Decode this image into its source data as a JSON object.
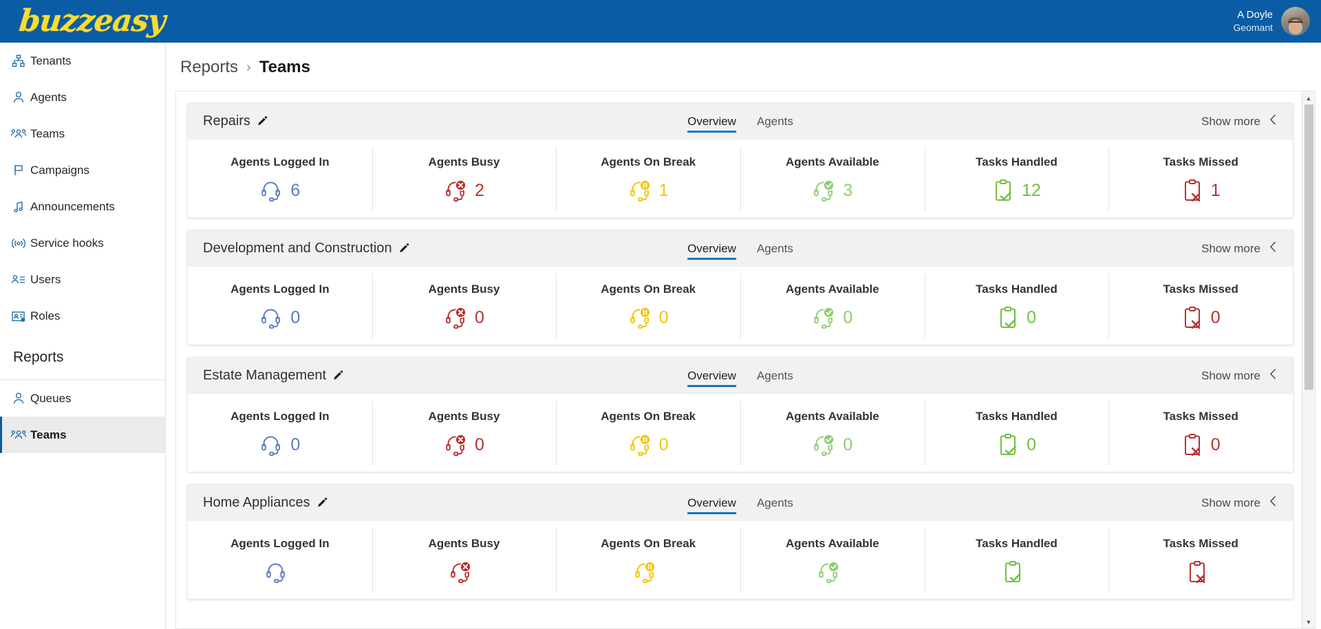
{
  "header": {
    "logo_text": "buzzeasy",
    "logo_color": "#fcdb2e",
    "bar_color": "#0a5ca4",
    "user": {
      "name": "A Doyle",
      "org": "Geomant"
    }
  },
  "sidebar": {
    "items": [
      {
        "label": "Tenants",
        "icon": "org-chart-icon",
        "active": false
      },
      {
        "label": "Agents",
        "icon": "person-icon",
        "active": false
      },
      {
        "label": "Teams",
        "icon": "people-group-icon",
        "active": false
      },
      {
        "label": "Campaigns",
        "icon": "flag-icon",
        "active": false
      },
      {
        "label": "Announcements",
        "icon": "music-note-icon",
        "active": false
      },
      {
        "label": "Service hooks",
        "icon": "broadcast-icon",
        "active": false
      },
      {
        "label": "Users",
        "icon": "person-list-icon",
        "active": false
      },
      {
        "label": "Roles",
        "icon": "badge-gear-icon",
        "active": false
      }
    ],
    "reports_heading": "Reports",
    "reports_items": [
      {
        "label": "Queues",
        "icon": "person-icon",
        "active": false
      },
      {
        "label": "Teams",
        "icon": "people-group-icon",
        "active": true
      }
    ]
  },
  "breadcrumb": {
    "parent": "Reports",
    "separator": "›",
    "current": "Teams"
  },
  "card_common": {
    "tabs": [
      {
        "label": "Overview",
        "active": true
      },
      {
        "label": "Agents",
        "active": false
      }
    ],
    "show_more_label": "Show more",
    "show_more_icon": "chevron-left-icon",
    "edit_icon": "pencil-icon",
    "metric_labels": [
      "Agents Logged In",
      "Agents Busy",
      "Agents On Break",
      "Agents Available",
      "Tasks Handled",
      "Tasks Missed"
    ],
    "metric_icons": [
      "headset-icon",
      "headset-busy-icon",
      "headset-break-icon",
      "headset-available-icon",
      "clipboard-check-icon",
      "clipboard-x-icon"
    ],
    "metric_colors": [
      "#5b7bc4",
      "#b93030",
      "#f5c400",
      "#8dcf6f",
      "#6fbf3f",
      "#b93030"
    ]
  },
  "cards": [
    {
      "title": "Repairs",
      "values": [
        "6",
        "2",
        "1",
        "3",
        "12",
        "1"
      ]
    },
    {
      "title": "Development and Construction",
      "values": [
        "0",
        "0",
        "0",
        "0",
        "0",
        "0"
      ]
    },
    {
      "title": "Estate Management",
      "values": [
        "0",
        "0",
        "0",
        "0",
        "0",
        "0"
      ]
    },
    {
      "title": "Home Appliances",
      "values": [
        "",
        "",
        "",
        "",
        "",
        ""
      ]
    }
  ],
  "scrollbar": {
    "up_arrow": "▲",
    "down_arrow": "▼"
  }
}
